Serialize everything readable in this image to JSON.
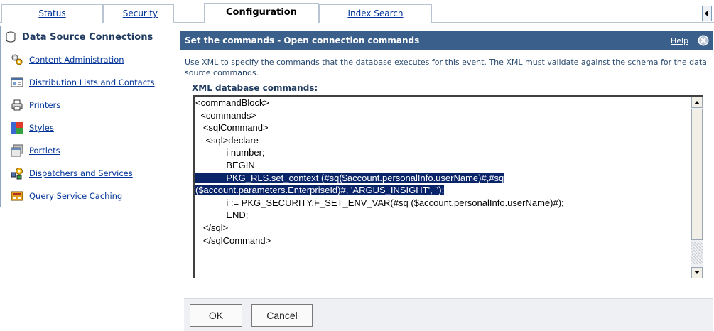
{
  "tabs": [
    {
      "label": "Status",
      "active": false
    },
    {
      "label": "Security",
      "active": false
    },
    {
      "label": "Configuration",
      "active": true
    },
    {
      "label": "Index Search",
      "active": false
    }
  ],
  "sidebar": {
    "header": {
      "label": "Data Source Connections",
      "icon": "cylinder-db-icon"
    },
    "items": [
      {
        "label": "Content Administration",
        "icon": "gears-icon"
      },
      {
        "label": "Distribution Lists and Contacts",
        "icon": "contacts-icon"
      },
      {
        "label": "Printers",
        "icon": "printer-icon"
      },
      {
        "label": "Styles",
        "icon": "styles-icon"
      },
      {
        "label": "Portlets",
        "icon": "portlets-icon"
      },
      {
        "label": "Dispatchers and Services",
        "icon": "dispatchers-icon"
      },
      {
        "label": "Query Service Caching",
        "icon": "cache-icon"
      }
    ]
  },
  "dialog": {
    "title": "Set the commands - Open connection commands",
    "help": "Help",
    "close_icon": "close-circle-icon",
    "description": "Use XML to specify the commands that the database executes for this event. The XML must validate against the schema for the data source commands.",
    "field_label": "XML database commands:",
    "xml_lines": [
      "<commandBlock>",
      "  <commands>",
      "   <sqlCommand>",
      "    <sql>declare",
      "            i number;",
      "            BEGIN",
      "            PKG_RLS.set_context (#sq($account.personalInfo.userName)#,#sq",
      "($account.parameters.EnterpriseId)#, 'ARGUS_INSIGHT', '');",
      "            i := PKG_SECURITY.F_SET_ENV_VAR(#sq ($account.personalInfo.userName)#);",
      "            END;",
      "   </sql>",
      "   </sqlCommand>"
    ],
    "ok_label": "OK",
    "cancel_label": "Cancel"
  },
  "colors": {
    "title_bar": "#3a5f8a",
    "link": "#003399",
    "selection": "#0a246a"
  }
}
